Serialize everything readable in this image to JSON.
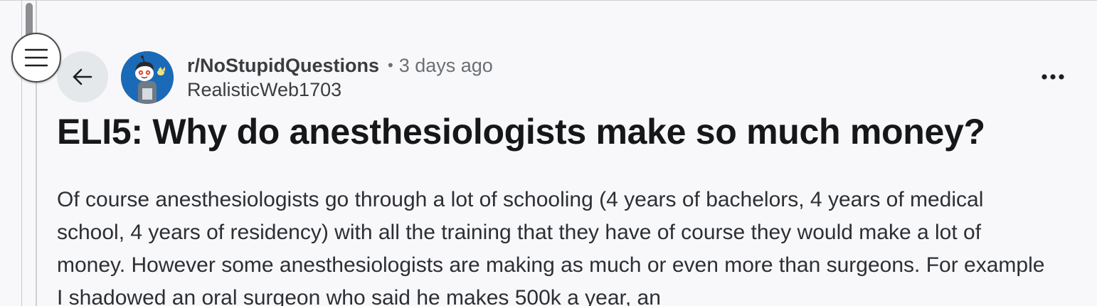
{
  "post": {
    "subreddit": "r/NoStupidQuestions",
    "separator": "•",
    "age": "3 days ago",
    "author": "RealisticWeb1703",
    "title": "ELI5: Why do anesthesiologists make so much money?",
    "body": "Of course anesthesiologists go through a lot of schooling (4 years of bachelors, 4 years of medical school, 4 years of residency) with all the training that they have of course they would make a lot of money. However some anesthesiologists are making as much or even more than surgeons. For example I shadowed an oral surgeon who said he makes 500k a year, an"
  },
  "icons": {
    "menu": "hamburger-menu-icon",
    "back": "arrow-left-icon",
    "avatar": "subreddit-snoo-avatar",
    "more": "more-horizontal-icon"
  },
  "colors": {
    "background": "#f8f8fa",
    "back_button_bg": "#e5e8eb",
    "avatar_bg": "#1a6ab8",
    "title_text": "#151719",
    "meta_text": "#6b6f73"
  }
}
